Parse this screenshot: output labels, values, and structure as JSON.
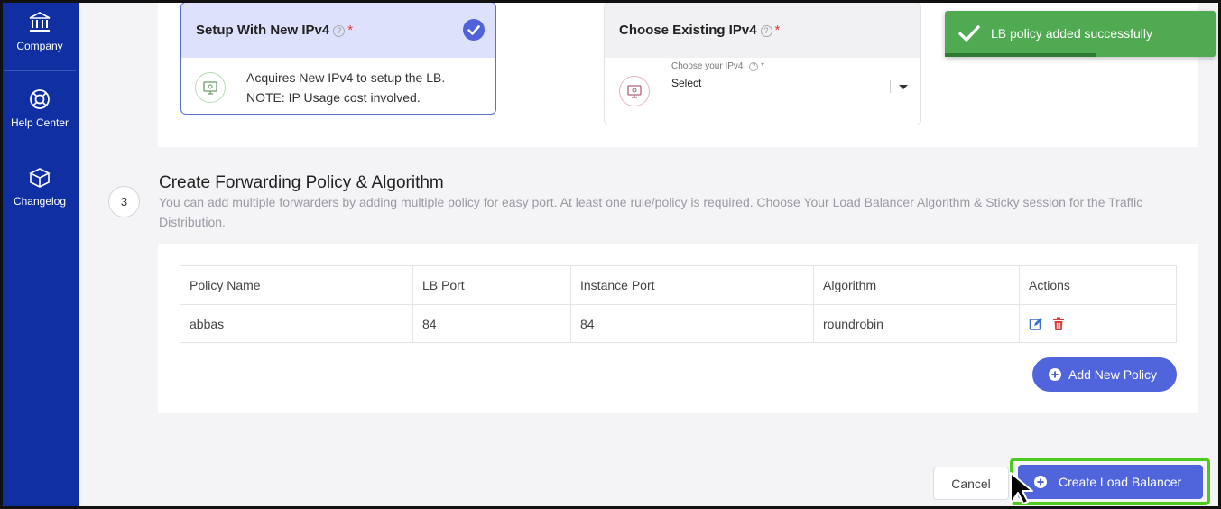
{
  "sidebar": {
    "items": [
      {
        "label": "Company",
        "icon": "bank-icon"
      },
      {
        "label": "Help Center",
        "icon": "lifebuoy-icon"
      },
      {
        "label": "Changelog",
        "icon": "box-icon"
      }
    ]
  },
  "ipv4": {
    "new_card": {
      "title": "Setup With New IPv4",
      "help": "?",
      "required": "*",
      "line1": "Acquires New IPv4 to setup the LB.",
      "line2": "NOTE: IP Usage cost involved.",
      "selected": true
    },
    "existing_card": {
      "title": "Choose Existing IPv4",
      "help": "?",
      "required": "*",
      "select_label": "Choose your IPv4",
      "select_help": "?",
      "select_required": "*",
      "select_value": "Select"
    }
  },
  "toast": {
    "message": "LB policy added successfully",
    "color": "#4faa52"
  },
  "section3": {
    "step": "3",
    "title": "Create Forwarding Policy & Algorithm",
    "description": "You can add multiple forwarders by adding multiple policy for easy port. At least one rule/policy is required. Choose Your Load Balancer Algorithm & Sticky session for the Traffic Distribution."
  },
  "table": {
    "headers": [
      "Policy Name",
      "LB Port",
      "Instance Port",
      "Algorithm",
      "Actions"
    ],
    "rows": [
      {
        "policy_name": "abbas",
        "lb_port": "84",
        "instance_port": "84",
        "algorithm": "roundrobin"
      }
    ]
  },
  "buttons": {
    "add_policy": "Add New Policy",
    "cancel": "Cancel",
    "create": "Create Load Balancer"
  },
  "colors": {
    "sidebar": "#0f2fa3",
    "primary": "#5064dc",
    "highlight": "#4ccb1e",
    "danger": "#e03a3a"
  }
}
